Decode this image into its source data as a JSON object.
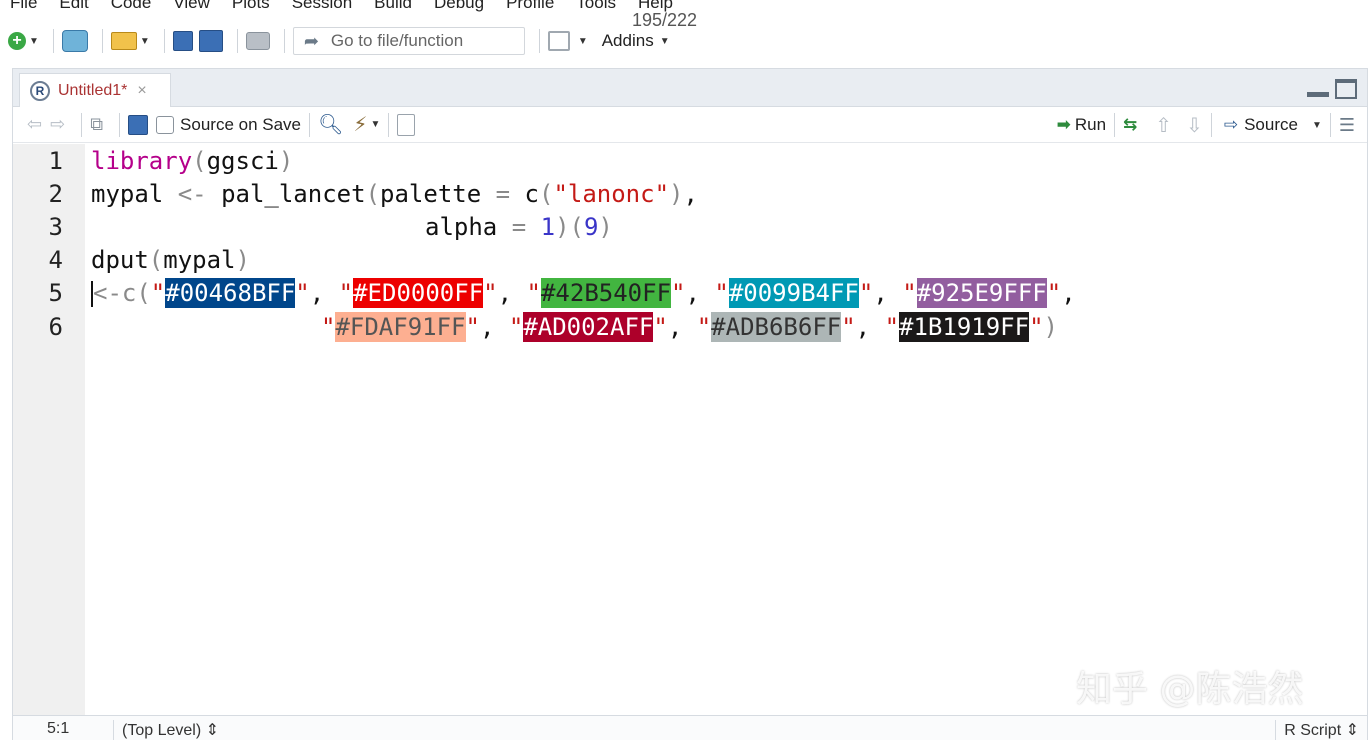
{
  "menu": [
    "File",
    "Edit",
    "Code",
    "View",
    "Plots",
    "Session",
    "Build",
    "Debug",
    "Profile",
    "Tools",
    "Help"
  ],
  "page_indicator": "195/222",
  "toolbar": {
    "goto_placeholder": "Go to file/function",
    "addins_label": "Addins",
    "icons": [
      "new-file-icon",
      "new-project-icon",
      "open-folder-icon",
      "save-icon",
      "save-all-icon",
      "print-icon",
      "grid-icon"
    ]
  },
  "tab": {
    "title": "Untitled1*",
    "close": "×"
  },
  "editor_toolbar": {
    "source_on_save": "Source on Save",
    "run_label": "Run",
    "source_label": "Source"
  },
  "code_lines": [
    {
      "n": "1"
    },
    {
      "n": "2"
    },
    {
      "n": "3"
    },
    {
      "n": "4"
    },
    {
      "n": "5"
    },
    {
      "n": "6"
    }
  ],
  "code": {
    "l1_fn": "library",
    "l1_arg": "ggsci",
    "l2_var": "mypal",
    "l2_assign": "<-",
    "l2_fn": "pal_lancet",
    "l2_arg": "palette",
    "l2_eq": "=",
    "l2_c": "c",
    "l2_str": "\"lanonc\"",
    "l3_arg": "alpha",
    "l3_eq": "=",
    "l3_num1": "1",
    "l3_num2": "9",
    "l4_fn": "dput",
    "l4_arg": "mypal",
    "l5_prefix": "<-c(",
    "swatches": [
      {
        "label": "#00468BFF",
        "color": "#00468B"
      },
      {
        "label": "#ED0000FF",
        "color": "#ED0000"
      },
      {
        "label": "#42B540FF",
        "color": "#42B540"
      },
      {
        "label": "#0099B4FF",
        "color": "#0099B4"
      },
      {
        "label": "#925E9FFF",
        "color": "#925E9F"
      },
      {
        "label": "#FDAF91FF",
        "color": "#FDAF91"
      },
      {
        "label": "#AD002AFF",
        "color": "#AD002A"
      },
      {
        "label": "#ADB6B6FF",
        "color": "#ADB6B6"
      },
      {
        "label": "#1B1919FF",
        "color": "#1B1919"
      }
    ]
  },
  "status": {
    "position": "5:1",
    "scope": "(Top Level) ⇕",
    "file_type": "R Script ⇕"
  },
  "watermark": "知乎 @陈浩然"
}
